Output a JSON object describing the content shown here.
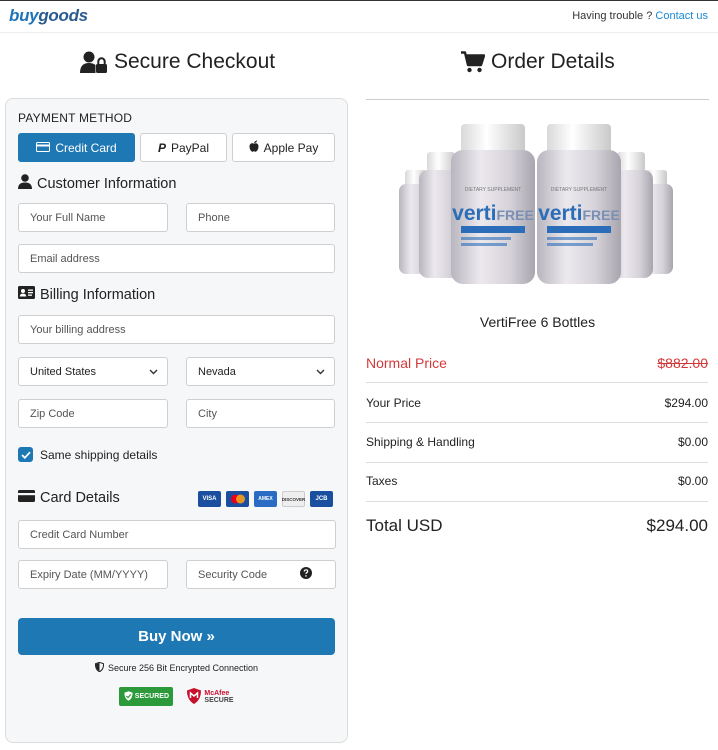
{
  "header": {
    "logo_buy": "buy",
    "logo_goods": "goods",
    "trouble_text": "Having trouble ?",
    "contact_link": "Contact us"
  },
  "left": {
    "title": "Secure Checkout",
    "payment_method_label": "PAYMENT METHOD",
    "payment_methods": [
      "Credit Card",
      "PayPal",
      "Apple Pay"
    ],
    "customer_heading": "Customer Information",
    "full_name_placeholder": "Your Full Name",
    "phone_placeholder": "Phone",
    "email_placeholder": "Email address",
    "billing_heading": "Billing Information",
    "billing_address_placeholder": "Your billing address",
    "country_value": "United States",
    "state_value": "Nevada",
    "zip_placeholder": "Zip Code",
    "city_placeholder": "City",
    "same_shipping_label": "Same shipping details",
    "card_heading": "Card Details",
    "card_brands": [
      "VISA",
      "Mastercard",
      "AMEX",
      "DISCOVER",
      "JCB"
    ],
    "card_number_placeholder": "Credit Card Number",
    "expiry_placeholder": "Expiry Date (MM/YYYY)",
    "security_code_placeholder": "Security Code",
    "buy_button": "Buy Now »",
    "secure_text": "Secure 256 Bit Encrypted Connection",
    "badge_secured_line1": "SECURED",
    "badge_mcafee_line1": "McAfee",
    "badge_mcafee_line2": "SECURE",
    "colors": {
      "accent": "#1e78b4",
      "panel_bg": "#f6f7f8"
    }
  },
  "right": {
    "title": "Order Details",
    "product_brand": "verti",
    "product_brand_suffix": "FREE",
    "product_label": "DIETARY SUPPLEMENT",
    "product_name": "VertiFree 6 Bottles",
    "rows": {
      "normal_label": "Normal Price",
      "normal_value": "$882.00",
      "your_price_label": "Your Price",
      "your_price_value": "$294.00",
      "shipping_label": "Shipping & Handling",
      "shipping_value": "$0.00",
      "taxes_label": "Taxes",
      "taxes_value": "$0.00",
      "total_label": "Total USD",
      "total_value": "$294.00"
    },
    "colors": {
      "strike_red": "#d23a3a"
    }
  }
}
